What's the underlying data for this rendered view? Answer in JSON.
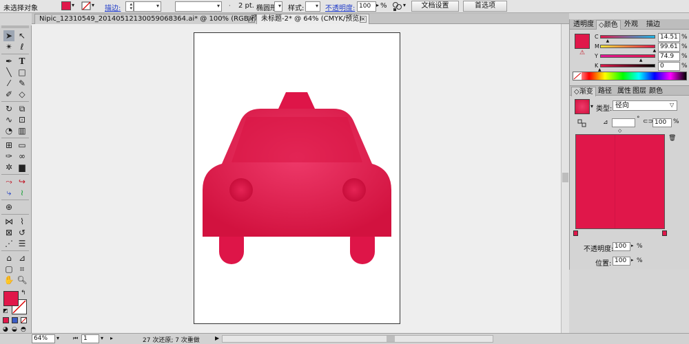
{
  "control_bar": {
    "selection_status": "未选择对象",
    "fill_color": "#e0174a",
    "stroke_label": "描边:",
    "stroke_weight": "2 pt.",
    "brush_name": "椭圆形",
    "style_label": "样式:",
    "opacity_label": "不透明度:",
    "opacity_value": "100",
    "opacity_unit": "%",
    "doc_setup_button": "文档设置",
    "preferences_button": "首选项"
  },
  "tabs": [
    {
      "label": "Nipic_12310549_20140512130059068364.ai* @ 100% (RGB/预览)",
      "active": false
    },
    {
      "label": "未标题-2* @ 64% (CMYK/预览)",
      "active": true
    }
  ],
  "color_panel": {
    "tabs": [
      "透明度",
      "颜色",
      "外观",
      "描边"
    ],
    "active_tab": "颜色",
    "swatch": "#e0174a",
    "channels": [
      {
        "name": "C",
        "value": "14.51",
        "fraction": 0.145
      },
      {
        "name": "M",
        "value": "99.61",
        "fraction": 0.996
      },
      {
        "name": "Y",
        "value": "74.9",
        "fraction": 0.749
      },
      {
        "name": "K",
        "value": "0",
        "fraction": 0.0
      }
    ]
  },
  "gradient_panel": {
    "tabs": [
      "渐变",
      "路径",
      "属性",
      "图层",
      "颜色"
    ],
    "active_tab": "渐变",
    "type_label": "类型:",
    "type_value": "径向",
    "angle_value": "",
    "angle_unit": "°",
    "aspect_value": "100",
    "aspect_unit": "%",
    "opacity_label": "不透明度:",
    "opacity_value": "100",
    "opacity_unit": "%",
    "location_label": "位置:",
    "location_value": "100",
    "location_unit": "%",
    "color": "#e0174a"
  },
  "status_bar": {
    "zoom": "64%",
    "artboard_number": "1",
    "history": "27 次还原; 7 次重做"
  },
  "artwork": {
    "car_color": "#e0174a",
    "car_highlight": "#ee3a6a",
    "car_shade": "#c90f3c"
  }
}
